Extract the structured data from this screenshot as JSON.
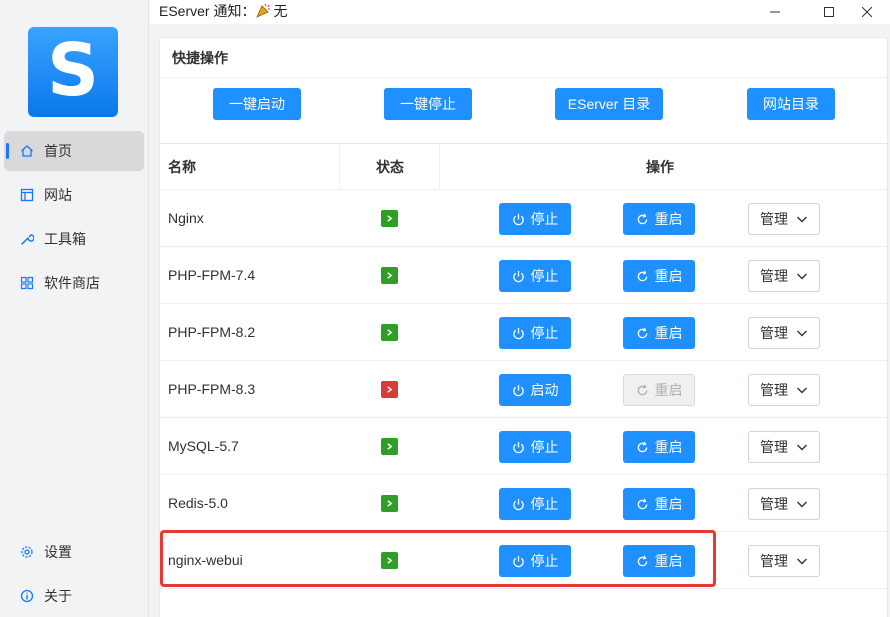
{
  "titlebar": {
    "title": "EServer 通知：",
    "notice": "无"
  },
  "sidebar": {
    "logo_letter": "S",
    "items": [
      {
        "label": "首页",
        "icon": "home-icon"
      },
      {
        "label": "网站",
        "icon": "website-icon"
      },
      {
        "label": "工具箱",
        "icon": "wrench-icon"
      },
      {
        "label": "软件商店",
        "icon": "grid-icon"
      }
    ],
    "bottom": [
      {
        "label": "设置",
        "icon": "gear-icon"
      },
      {
        "label": "关于",
        "icon": "info-icon"
      }
    ]
  },
  "quick": {
    "title": "快捷操作",
    "buttons": [
      "一键启动",
      "一键停止",
      "EServer 目录",
      "网站目录"
    ]
  },
  "table": {
    "headers": {
      "name": "名称",
      "status": "状态",
      "actions": "操作"
    },
    "rows": [
      {
        "name": "Nginx",
        "running": true,
        "primary": "停止",
        "secondary": "重启",
        "manage": "管理"
      },
      {
        "name": "PHP-FPM-7.4",
        "running": true,
        "primary": "停止",
        "secondary": "重启",
        "manage": "管理"
      },
      {
        "name": "PHP-FPM-8.2",
        "running": true,
        "primary": "停止",
        "secondary": "重启",
        "manage": "管理"
      },
      {
        "name": "PHP-FPM-8.3",
        "running": false,
        "primary": "启动",
        "secondary": "重启",
        "manage": "管理"
      },
      {
        "name": "MySQL-5.7",
        "running": true,
        "primary": "停止",
        "secondary": "重启",
        "manage": "管理"
      },
      {
        "name": "Redis-5.0",
        "running": true,
        "primary": "停止",
        "secondary": "重启",
        "manage": "管理"
      },
      {
        "name": "nginx-webui",
        "running": true,
        "primary": "停止",
        "secondary": "重启",
        "manage": "管理"
      }
    ]
  },
  "colors": {
    "accent": "#1e90ff",
    "running": "#2f9e26",
    "stopped": "#d93a3a",
    "highlight": "#e53935"
  }
}
